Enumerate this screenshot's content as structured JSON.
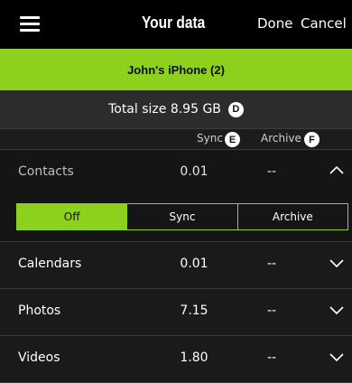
{
  "header": {
    "title": "Your data",
    "done_label": "Done",
    "cancel_label": "Cancel",
    "menu_icon": "hamburger-menu-icon"
  },
  "device": {
    "name": "John's iPhone (2)"
  },
  "summary": {
    "total_size_label": "Total size 8.95 GB",
    "badge": "D"
  },
  "columns": {
    "sync_label": "Sync",
    "sync_badge": "E",
    "archive_label": "Archive",
    "archive_badge": "F"
  },
  "rows": [
    {
      "name": "Contacts",
      "size": "0.01",
      "archive": "--",
      "expanded": true
    },
    {
      "name": "Calendars",
      "size": "0.01",
      "archive": "--",
      "expanded": false
    },
    {
      "name": "Photos",
      "size": "7.15",
      "archive": "--",
      "expanded": false
    },
    {
      "name": "Videos",
      "size": "1.80",
      "archive": "--",
      "expanded": false
    }
  ],
  "segment": {
    "options": [
      "Off",
      "Sync",
      "Archive"
    ],
    "selected": "Off"
  },
  "colors": {
    "accent": "#8ed11c",
    "background": "#1a1a1a",
    "topbar": "#000000"
  }
}
